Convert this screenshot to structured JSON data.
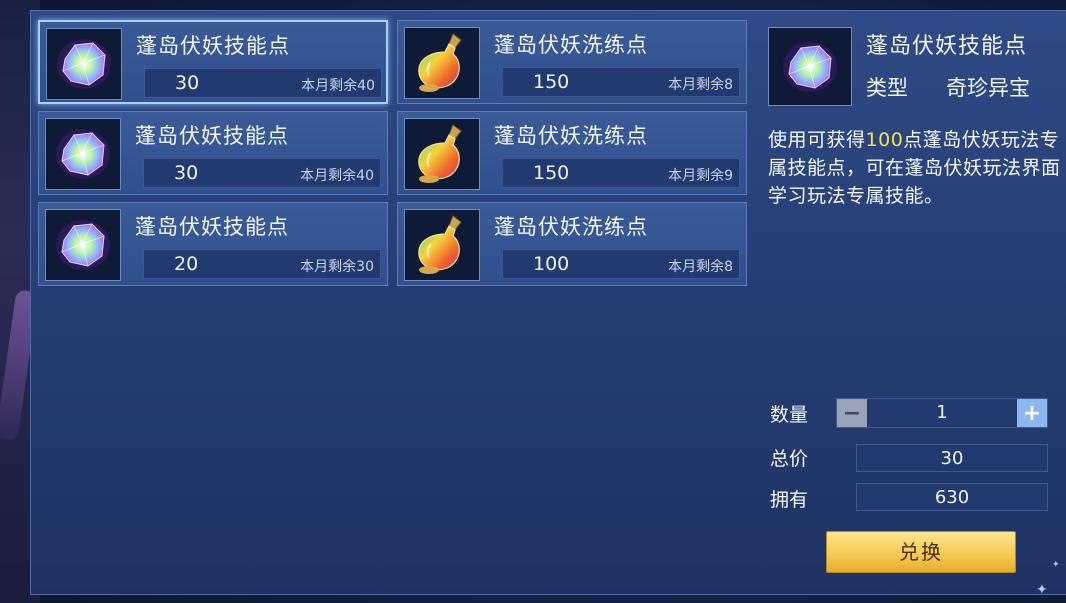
{
  "items": [
    {
      "name": "蓬岛伏妖技能点",
      "price": "30",
      "remain": "本月剩余40",
      "icon": "crystal-icon",
      "selected": true
    },
    {
      "name": "蓬岛伏妖洗练点",
      "price": "150",
      "remain": "本月剩余8",
      "icon": "potion-icon",
      "selected": false
    },
    {
      "name": "蓬岛伏妖技能点",
      "price": "30",
      "remain": "本月剩余40",
      "icon": "crystal-icon",
      "selected": false
    },
    {
      "name": "蓬岛伏妖洗练点",
      "price": "150",
      "remain": "本月剩余9",
      "icon": "potion-icon",
      "selected": false
    },
    {
      "name": "蓬岛伏妖技能点",
      "price": "20",
      "remain": "本月剩余30",
      "icon": "crystal-icon",
      "selected": false
    },
    {
      "name": "蓬岛伏妖洗练点",
      "price": "100",
      "remain": "本月剩余8",
      "icon": "potion-icon",
      "selected": false
    }
  ],
  "detail": {
    "name": "蓬岛伏妖技能点",
    "type_label": "类型",
    "type_value": "奇珍异宝",
    "desc_prefix": "使用可获得",
    "desc_highlight": "100",
    "desc_suffix": "点蓬岛伏妖玩法专属技能点，可在蓬岛伏妖玩法界面学习玩法专属技能。"
  },
  "purchase": {
    "quantity_label": "数量",
    "quantity": "1",
    "minus": "−",
    "plus": "+",
    "total_label": "总价",
    "total": "30",
    "owned_label": "拥有",
    "owned": "630",
    "exchange_label": "兑换"
  },
  "colors": {
    "highlight": "#f5e44a",
    "button_gold": "#f6c84e"
  }
}
